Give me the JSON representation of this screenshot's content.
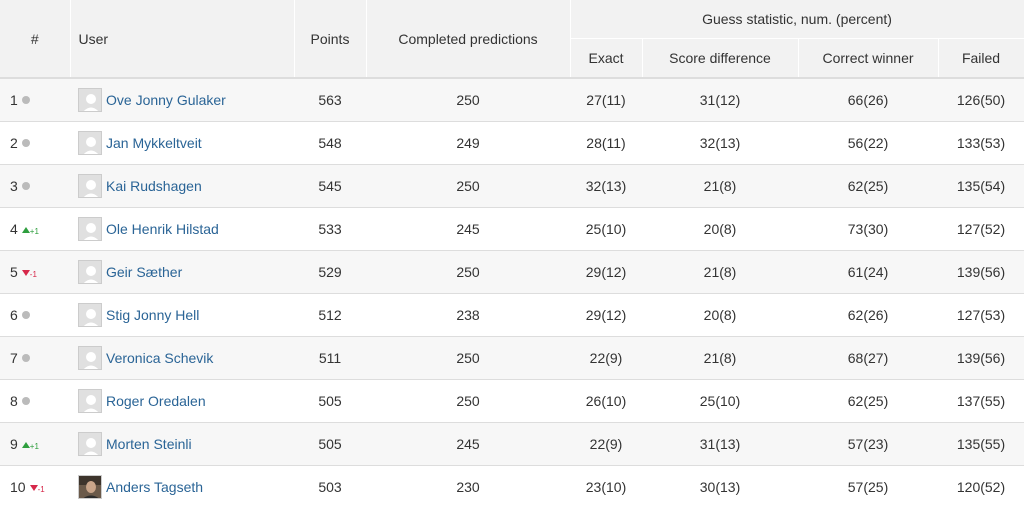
{
  "header": {
    "rank": "#",
    "user": "User",
    "points": "Points",
    "completed": "Completed predictions",
    "group": "Guess statistic, num. (percent)",
    "exact": "Exact",
    "score_diff": "Score difference",
    "correct_winner": "Correct winner",
    "failed": "Failed"
  },
  "colors": {
    "up": "#2e9e3e",
    "down": "#d6284a",
    "neutral": "#bbbbbb",
    "link": "#2a6496"
  },
  "rows": [
    {
      "rank": "1",
      "trend": "same",
      "change": "",
      "user": "Ove Jonny Gulaker",
      "avatar": "placeholder-avatar",
      "points": "563",
      "completed": "250",
      "exact": "27(11)",
      "score_diff": "31(12)",
      "correct_winner": "66(26)",
      "failed": "126(50)"
    },
    {
      "rank": "2",
      "trend": "same",
      "change": "",
      "user": "Jan Mykkeltveit",
      "avatar": "placeholder-avatar",
      "points": "548",
      "completed": "249",
      "exact": "28(11)",
      "score_diff": "32(13)",
      "correct_winner": "56(22)",
      "failed": "133(53)"
    },
    {
      "rank": "3",
      "trend": "same",
      "change": "",
      "user": "Kai Rudshagen",
      "avatar": "placeholder-avatar",
      "points": "545",
      "completed": "250",
      "exact": "32(13)",
      "score_diff": "21(8)",
      "correct_winner": "62(25)",
      "failed": "135(54)"
    },
    {
      "rank": "4",
      "trend": "up",
      "change": "+1",
      "user": "Ole Henrik Hilstad",
      "avatar": "placeholder-avatar",
      "points": "533",
      "completed": "245",
      "exact": "25(10)",
      "score_diff": "20(8)",
      "correct_winner": "73(30)",
      "failed": "127(52)"
    },
    {
      "rank": "5",
      "trend": "down",
      "change": "-1",
      "user": "Geir Sæther",
      "avatar": "placeholder-avatar",
      "points": "529",
      "completed": "250",
      "exact": "29(12)",
      "score_diff": "21(8)",
      "correct_winner": "61(24)",
      "failed": "139(56)"
    },
    {
      "rank": "6",
      "trend": "same",
      "change": "",
      "user": "Stig Jonny Hell",
      "avatar": "placeholder-avatar",
      "points": "512",
      "completed": "238",
      "exact": "29(12)",
      "score_diff": "20(8)",
      "correct_winner": "62(26)",
      "failed": "127(53)"
    },
    {
      "rank": "7",
      "trend": "same",
      "change": "",
      "user": "Veronica Schevik",
      "avatar": "placeholder-avatar",
      "points": "511",
      "completed": "250",
      "exact": "22(9)",
      "score_diff": "21(8)",
      "correct_winner": "68(27)",
      "failed": "139(56)"
    },
    {
      "rank": "8",
      "trend": "same",
      "change": "",
      "user": "Roger Oredalen",
      "avatar": "placeholder-avatar",
      "points": "505",
      "completed": "250",
      "exact": "26(10)",
      "score_diff": "25(10)",
      "correct_winner": "62(25)",
      "failed": "137(55)"
    },
    {
      "rank": "9",
      "trend": "up",
      "change": "+1",
      "user": "Morten Steinli",
      "avatar": "placeholder-avatar",
      "points": "505",
      "completed": "245",
      "exact": "22(9)",
      "score_diff": "31(13)",
      "correct_winner": "57(23)",
      "failed": "135(55)"
    },
    {
      "rank": "10",
      "trend": "down",
      "change": "-1",
      "user": "Anders Tagseth",
      "avatar": "photo-avatar",
      "points": "503",
      "completed": "230",
      "exact": "23(10)",
      "score_diff": "30(13)",
      "correct_winner": "57(25)",
      "failed": "120(52)"
    }
  ]
}
